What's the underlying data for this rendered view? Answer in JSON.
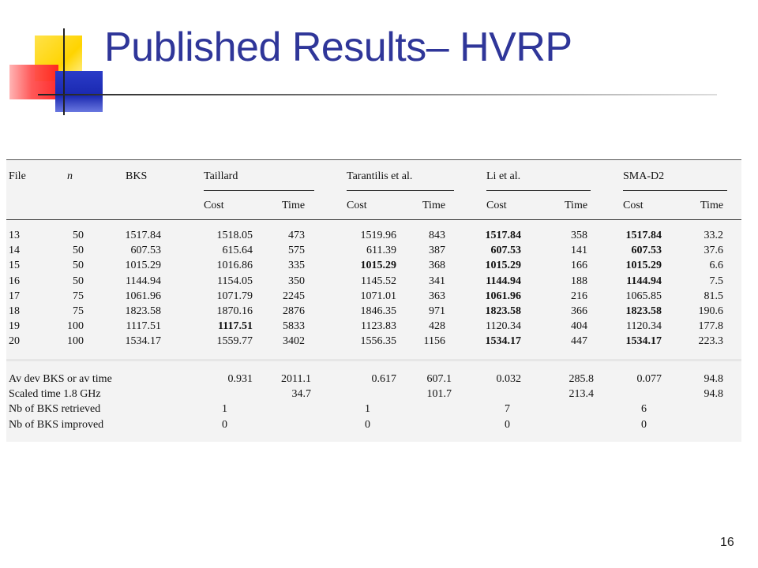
{
  "slide": {
    "title": "Published Results– HVRP",
    "page_number": "16"
  },
  "table": {
    "headers": {
      "file": "File",
      "n": "n",
      "bks": "BKS",
      "groups": [
        "Taillard",
        "Tarantilis et al.",
        "Li et al.",
        "SMA-D2"
      ],
      "cost": "Cost",
      "time": "Time"
    },
    "rows": [
      {
        "file": "13",
        "n": "50",
        "bks": "1517.84",
        "cells": [
          [
            "1518.05",
            "473"
          ],
          [
            "1519.96",
            "843"
          ],
          [
            "1517.84",
            "358"
          ],
          [
            "1517.84",
            "33.2"
          ]
        ],
        "bold": [
          false,
          false,
          true,
          true
        ]
      },
      {
        "file": "14",
        "n": "50",
        "bks": "607.53",
        "cells": [
          [
            "615.64",
            "575"
          ],
          [
            "611.39",
            "387"
          ],
          [
            "607.53",
            "141"
          ],
          [
            "607.53",
            "37.6"
          ]
        ],
        "bold": [
          false,
          false,
          true,
          true
        ]
      },
      {
        "file": "15",
        "n": "50",
        "bks": "1015.29",
        "cells": [
          [
            "1016.86",
            "335"
          ],
          [
            "1015.29",
            "368"
          ],
          [
            "1015.29",
            "166"
          ],
          [
            "1015.29",
            "6.6"
          ]
        ],
        "bold": [
          false,
          true,
          true,
          true
        ]
      },
      {
        "file": "16",
        "n": "50",
        "bks": "1144.94",
        "cells": [
          [
            "1154.05",
            "350"
          ],
          [
            "1145.52",
            "341"
          ],
          [
            "1144.94",
            "188"
          ],
          [
            "1144.94",
            "7.5"
          ]
        ],
        "bold": [
          false,
          false,
          true,
          true
        ]
      },
      {
        "file": "17",
        "n": "75",
        "bks": "1061.96",
        "cells": [
          [
            "1071.79",
            "2245"
          ],
          [
            "1071.01",
            "363"
          ],
          [
            "1061.96",
            "216"
          ],
          [
            "1065.85",
            "81.5"
          ]
        ],
        "bold": [
          false,
          false,
          true,
          false
        ]
      },
      {
        "file": "18",
        "n": "75",
        "bks": "1823.58",
        "cells": [
          [
            "1870.16",
            "2876"
          ],
          [
            "1846.35",
            "971"
          ],
          [
            "1823.58",
            "366"
          ],
          [
            "1823.58",
            "190.6"
          ]
        ],
        "bold": [
          false,
          false,
          true,
          true
        ]
      },
      {
        "file": "19",
        "n": "100",
        "bks": "1117.51",
        "cells": [
          [
            "1117.51",
            "5833"
          ],
          [
            "1123.83",
            "428"
          ],
          [
            "1120.34",
            "404"
          ],
          [
            "1120.34",
            "177.8"
          ]
        ],
        "bold": [
          true,
          false,
          false,
          false
        ]
      },
      {
        "file": "20",
        "n": "100",
        "bks": "1534.17",
        "cells": [
          [
            "1559.77",
            "3402"
          ],
          [
            "1556.35",
            "1156"
          ],
          [
            "1534.17",
            "447"
          ],
          [
            "1534.17",
            "223.3"
          ]
        ],
        "bold": [
          false,
          false,
          true,
          true
        ]
      }
    ],
    "summary": [
      {
        "label": "Av dev BKS or av time",
        "cells": [
          [
            "0.931",
            "2011.1"
          ],
          [
            "0.617",
            "607.1"
          ],
          [
            "0.032",
            "285.8"
          ],
          [
            "0.077",
            "94.8"
          ]
        ]
      },
      {
        "label": "Scaled time 1.8 GHz",
        "cells": [
          [
            "",
            "34.7"
          ],
          [
            "",
            "101.7"
          ],
          [
            "",
            "213.4"
          ],
          [
            "",
            "94.8"
          ]
        ]
      },
      {
        "label": "Nb of BKS retrieved",
        "cells": [
          [
            "1",
            ""
          ],
          [
            "1",
            ""
          ],
          [
            "7",
            ""
          ],
          [
            "6",
            ""
          ]
        ]
      },
      {
        "label": "Nb of BKS improved",
        "cells": [
          [
            "0",
            ""
          ],
          [
            "0",
            ""
          ],
          [
            "0",
            ""
          ],
          [
            "0",
            ""
          ]
        ]
      }
    ]
  }
}
